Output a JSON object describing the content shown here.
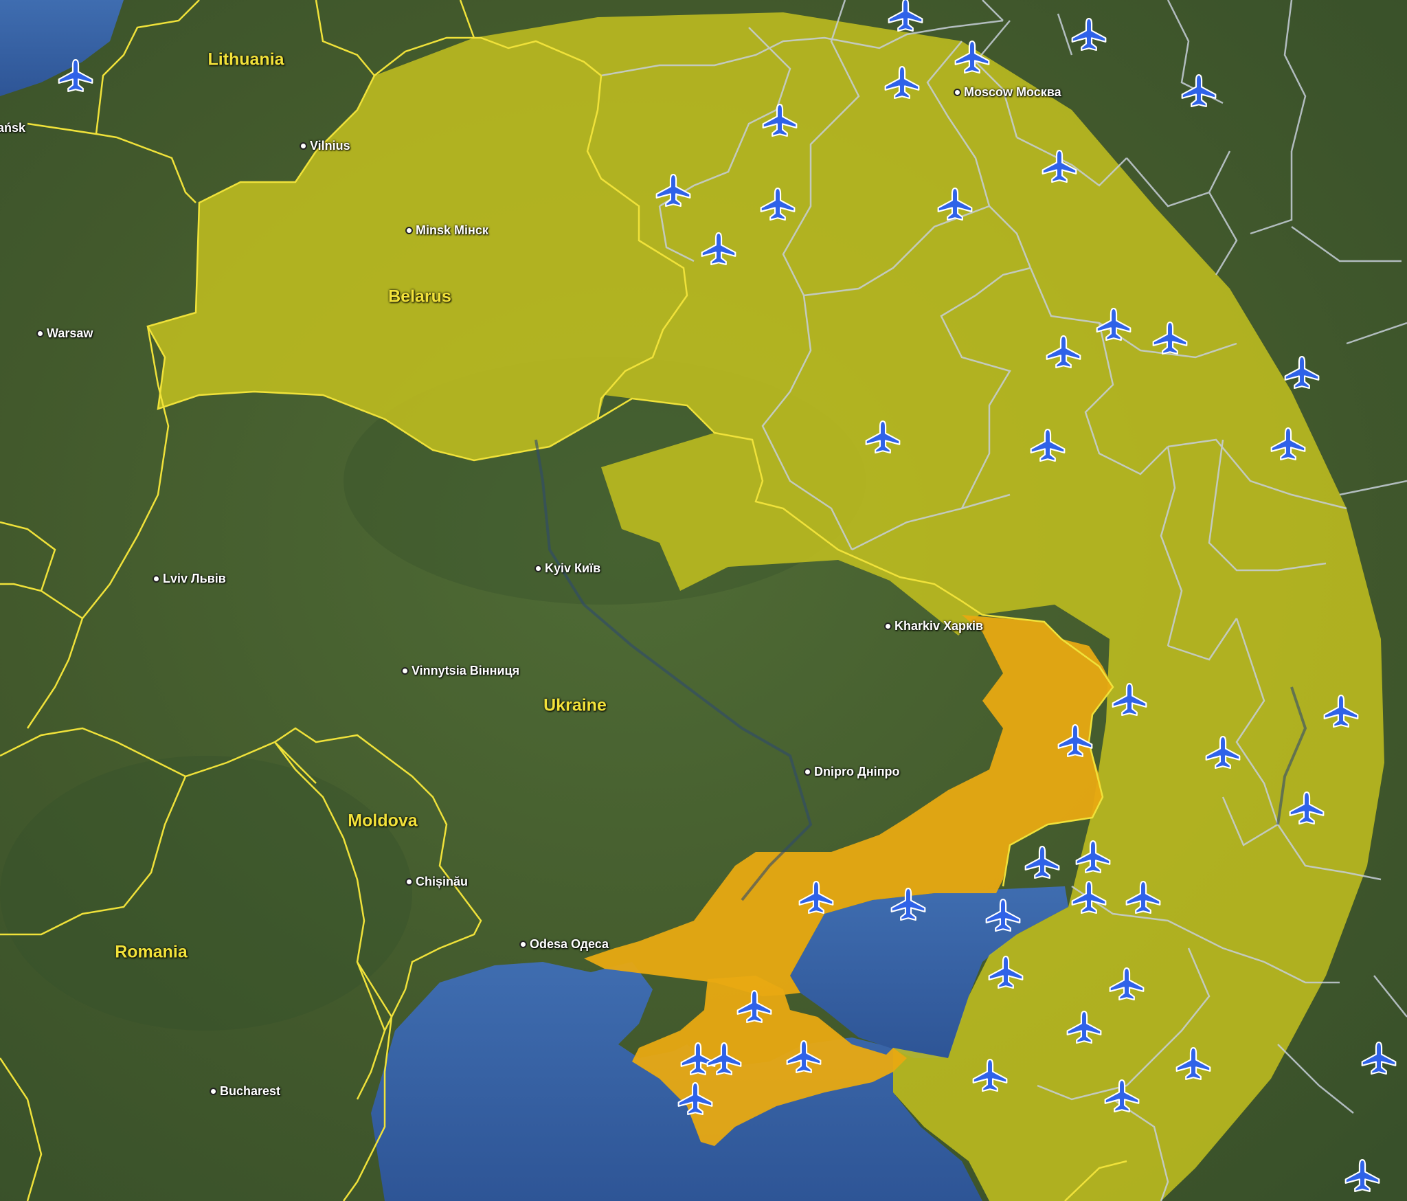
{
  "countries": {
    "lithuania": "Lithuania",
    "belarus": "Belarus",
    "ukraine": "Ukraine",
    "moldova": "Moldova",
    "romania": "Romania"
  },
  "cities": {
    "gdansk": "ańsk",
    "vilnius": "Vilnius",
    "minsk": "Minsk Мінск",
    "moscow": "Moscow Москва",
    "warsaw": "Warsaw",
    "kyiv": "Kyiv Київ",
    "lviv": "Lviv Львів",
    "kharkiv": "Kharkiv Харків",
    "vinnytsia": "Vinnytsia Вінниця",
    "dnipro": "Dnipro Дніпро",
    "chisinau": "Chișinău",
    "odesa": "Odesa Одеса",
    "bucharest": "Bucharest"
  },
  "colors": {
    "range_zone": "#c8c41e",
    "occupied": "#e8a912",
    "border": "#f0e23a",
    "sea": "#3a64a6",
    "land": "#45602f",
    "airbase_icon": "#2f62e8"
  },
  "icon": "airplane-icon"
}
